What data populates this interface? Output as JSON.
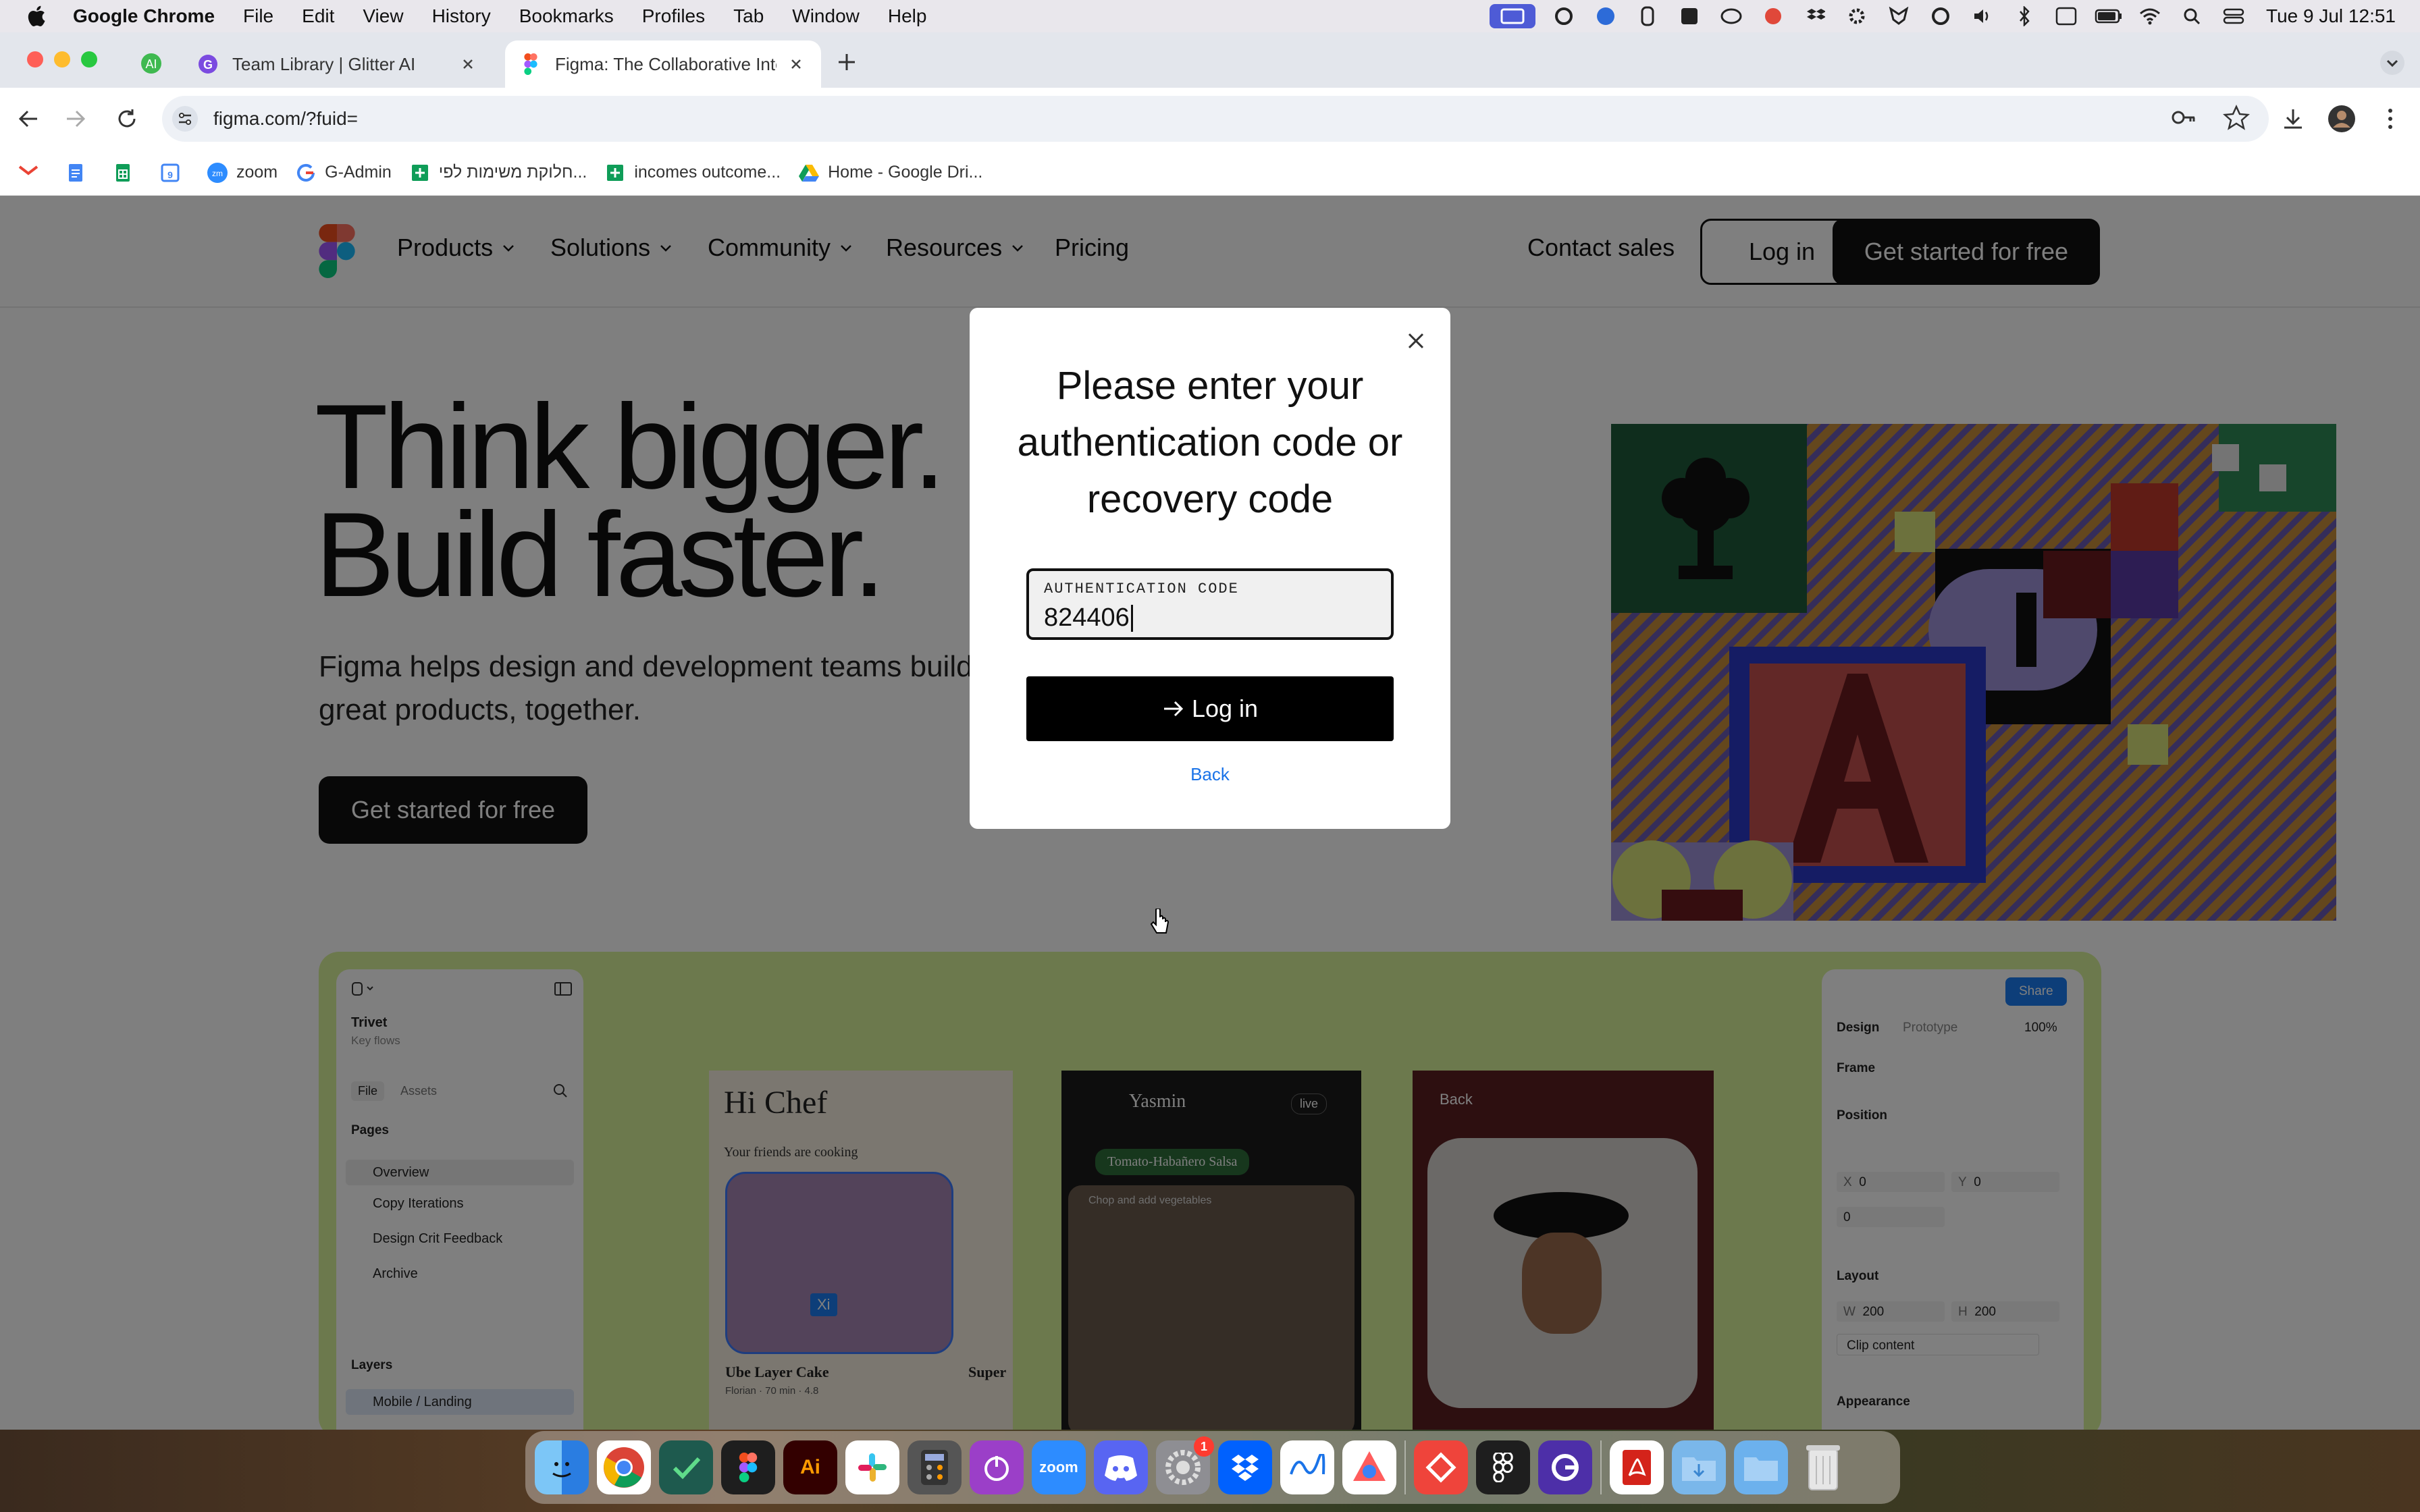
{
  "menubar": {
    "app_name": "Google Chrome",
    "items": [
      "File",
      "Edit",
      "View",
      "History",
      "Bookmarks",
      "Profiles",
      "Tab",
      "Window",
      "Help"
    ],
    "clock": "Tue 9 Jul  12:51"
  },
  "browser": {
    "tabs": [
      {
        "title": "Team Library | Glitter AI",
        "active": false
      },
      {
        "title": "Figma: The Collaborative Inte",
        "active": true
      }
    ],
    "url": "figma.com/?fuid=",
    "bookmarks": [
      "zoom",
      "G-Admin",
      "חלוקת משימות לפי...",
      "incomes outcome...",
      "Home - Google Dri..."
    ]
  },
  "site": {
    "nav": [
      "Products",
      "Solutions",
      "Community",
      "Resources",
      "Pricing"
    ],
    "contact": "Contact sales",
    "login": "Log in",
    "cta": "Get started for free",
    "hero_line1": "Think bigger.",
    "hero_line2": "Build faster.",
    "hero_sub": "Figma helps design and development teams build great products, together.",
    "hero_cta": "Get started for free"
  },
  "mock": {
    "file_name": "Trivet",
    "file_sub": "Key flows",
    "tab_file": "File",
    "tab_assets": "Assets",
    "pages_label": "Pages",
    "pages": [
      "Overview",
      "Copy Iterations",
      "Design Crit Feedback",
      "Archive"
    ],
    "layers_label": "Layers",
    "layer": "Mobile / Landing",
    "frame1_title": "Hi Chef",
    "frame1_sub": "Your friends are cooking",
    "frame1_card": "Ube Layer Cake",
    "frame1_meta": "Florian · 70 min · 4.8",
    "frame1_card2": "Super",
    "frame2_name": "Yasmin",
    "frame2_live": "live",
    "frame2_chip": "Tomato-Habañero Salsa",
    "frame2_input": "Chop and add vegetables",
    "frame3_back": "Back",
    "cursor_tag": "Xi",
    "share": "Share",
    "tab_design": "Design",
    "tab_prototype": "Prototype",
    "zoom": "100%",
    "frame_label": "Frame",
    "position_label": "Position",
    "x_label": "X",
    "x_val": "0",
    "y_label": "Y",
    "y_val": "0",
    "r_val": "0",
    "layout_label": "Layout",
    "w_label": "W",
    "w_val": "200",
    "h_label": "H",
    "h_val": "200",
    "clip_label": "Clip content",
    "appearance_label": "Appearance"
  },
  "modal": {
    "title": "Please enter your authentication code or recovery code",
    "field_label": "AUTHENTICATION CODE",
    "field_value": "824406",
    "submit": "Log in",
    "back": "Back"
  },
  "dock": {
    "apps": [
      "Finder",
      "Chrome",
      "TickTick",
      "Figma",
      "Illustrator",
      "Slack",
      "Calculator",
      "Focus",
      "Zoom",
      "Discord",
      "System Settings",
      "Dropbox",
      "Freeform",
      "Pixelmator",
      "AnyDesk",
      "Figma Desktop",
      "Glitter",
      "Acrobat",
      "Downloads",
      "Folder",
      "Trash"
    ],
    "settings_badge": "1"
  }
}
